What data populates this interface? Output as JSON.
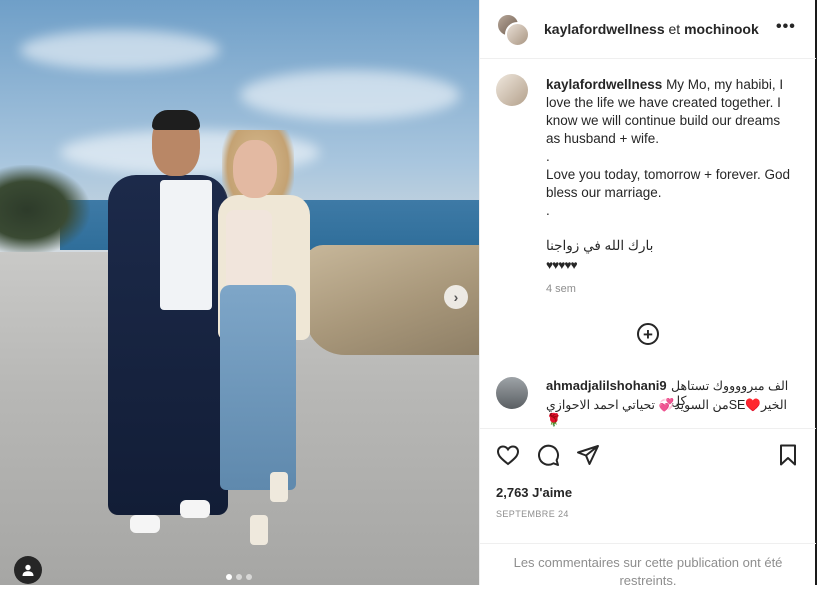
{
  "post": {
    "photo_alt_icon": "user-tag-icon",
    "carousel": {
      "count": 3,
      "active_index": 0
    }
  },
  "header": {
    "username_primary": "kaylafordwellness",
    "joiner": " et ",
    "username_secondary": "mochinook",
    "more_label": "•••"
  },
  "caption": {
    "username": "kaylafordwellness",
    "text": " My Mo, my habibi, I love the life we have created together. I know we will continue build our dreams as husband + wife.\n.\nLove you today, tomorrow + forever. God bless our marriage.\n.",
    "arabic": "بارك الله في زواجنا",
    "hearts": "♥♥♥♥♥",
    "time_ago": "4 sem"
  },
  "load_more_label": "+",
  "comments": [
    {
      "username": "ahmadjalilshohani9",
      "text_line1": "الف مبرووووك تستاهل كل",
      "text_line2": "الخير♥️SEمن السويد💞 تحياتي احمد الاحوازي 🌹"
    }
  ],
  "actions": {
    "icons": [
      "heart-icon",
      "comment-icon",
      "share-icon",
      "bookmark-icon"
    ],
    "likes": "2,763 J'aime",
    "date": "SEPTEMBRE 24"
  },
  "restricted_notice": "Les commentaires sur cette publication ont été restreints."
}
